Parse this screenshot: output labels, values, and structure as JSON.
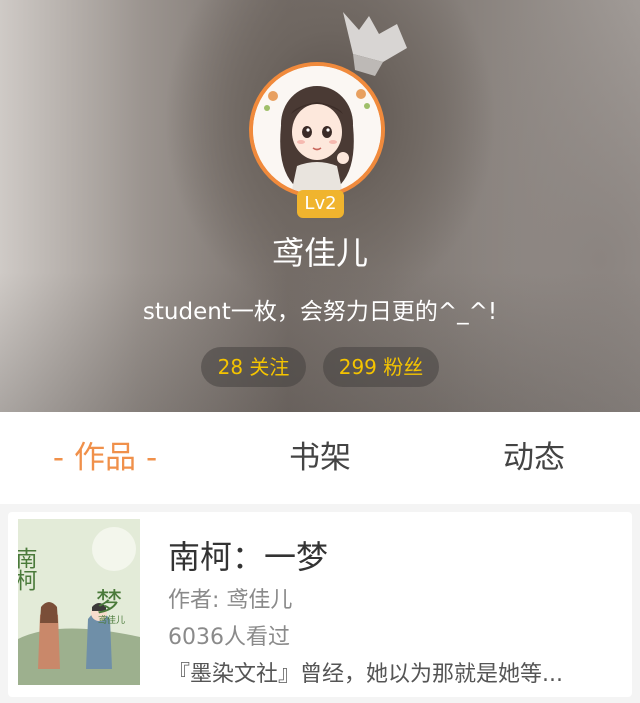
{
  "profile": {
    "level": "Lv2",
    "username": "鸢佳儿",
    "bio": "student一枚，会努力日更的^_^!",
    "following": "28 关注",
    "fans": "299 粉丝"
  },
  "tabs": {
    "works": "作品",
    "works_dash_left": "-",
    "works_dash_right": "-",
    "shelf": "书架",
    "feed": "动态"
  },
  "book": {
    "title": "南柯：一梦",
    "author": "作者: 鸢佳儿",
    "views": "6036人看过",
    "intro": "『墨染文社』曾经，她以为那就是她等...",
    "cover_text": {
      "title_main": "南柯",
      "title_sub": "梦",
      "author_small": "鸢佳儿"
    }
  },
  "colors": {
    "accent": "#f0904a",
    "avatar_ring": "#f08a3c",
    "level_badge": "#f0b42e",
    "stat_text": "#f5c400"
  },
  "icons": {
    "decoration": "paper-flower-icon"
  }
}
